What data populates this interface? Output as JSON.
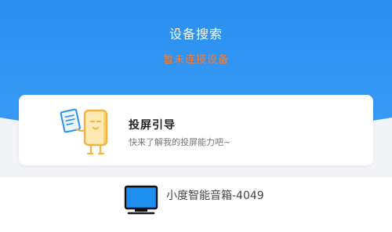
{
  "header": {
    "title": "设备搜索",
    "subtitle": "暂未连接设备",
    "background_color": "#2b8ff0",
    "subtitle_color": "#ee7f3a"
  },
  "guide_card": {
    "title": "投屏引导",
    "description": "快来了解我的投屏能力吧~",
    "illustration": "phone-character-holding-document-icon"
  },
  "devices": [
    {
      "name": "小度智能音箱-4049",
      "icon": "tv-icon"
    }
  ]
}
